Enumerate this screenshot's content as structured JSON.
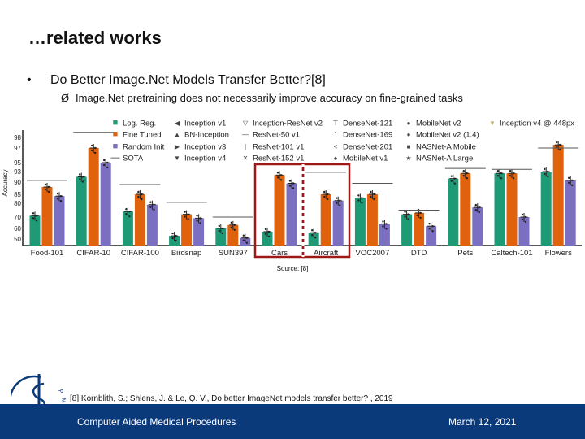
{
  "slide": {
    "title": "…related works",
    "bullet_symbol": "•",
    "bullet_text": "Do Better Image.Net Models Transfer Better?[8]",
    "sub_bullet_symbol": "Ø",
    "sub_bullet_text": "Image.Net pretraining does not necessarily improve accuracy on fine-grained tasks",
    "source": "Source: [8]",
    "reference": "[8] Kornblith, S.; Shlens, J. & Le, Q. V., Do better ImageNet models transfer better? , 2019",
    "footer_left": "Computer Aided Medical Procedures",
    "footer_right": "March 12, 2021",
    "logo_text": "CAMP",
    "footer_color": "#0b3a7a"
  },
  "chart_data": {
    "type": "bar",
    "ylabel": "Accuracy",
    "y_ticks": [
      50,
      60,
      70,
      80,
      85,
      90,
      93,
      95,
      97,
      98
    ],
    "y_scale": "nonlinear (logit-like)",
    "categories": [
      "Food-101",
      "CIFAR-10",
      "CIFAR-100",
      "Birdsnap",
      "SUN397",
      "Cars",
      "Aircraft",
      "VOC2007",
      "DTD",
      "Pets",
      "Caltech-101",
      "Flowers"
    ],
    "series": [
      {
        "name": "Log. Reg.",
        "color": "#1f9a77",
        "values": [
          71,
          91.5,
          74,
          53,
          60,
          57,
          56,
          83,
          72,
          91,
          92.5,
          93
        ]
      },
      {
        "name": "Fine Tuned",
        "color": "#e0620c",
        "values": [
          88,
          97,
          85,
          72,
          63,
          92,
          85,
          85,
          73,
          92.5,
          92.5,
          97.3
        ]
      },
      {
        "name": "Random Init",
        "color": "#7a6fc0",
        "values": [
          84,
          95,
          79,
          69,
          51,
          89.5,
          81.5,
          64,
          62,
          77,
          70,
          90.5
        ]
      },
      {
        "name": "SOTA",
        "color": "#333333",
        "values": [
          90.5,
          98.5,
          89,
          80.5,
          70,
          94,
          92.8,
          89.5,
          75,
          93.7,
          93.5,
          97
        ]
      }
    ],
    "legend_columns": [
      [
        "Log. Reg.",
        "Fine Tuned",
        "Random Init",
        "SOTA"
      ],
      [
        "Inception v1",
        "BN-Inception",
        "Inception v3",
        "Inception v4"
      ],
      [
        "Inception-ResNet v2",
        "ResNet-50 v1",
        "ResNet-101 v1",
        "ResNet-152 v1"
      ],
      [
        "DenseNet-121",
        "DenseNet-169",
        "DenseNet-201",
        "MobileNet v1"
      ],
      [
        "MobileNet v2",
        "MobileNet v2 (1.4)",
        "NASNet-A Mobile",
        "NASNet-A Large"
      ],
      [
        "Inception v4 @ 448px"
      ]
    ],
    "legend_markers": [
      [
        "■",
        "■",
        "■",
        "—"
      ],
      [
        "◀",
        "▲",
        "▶",
        "▼"
      ],
      [
        "▽",
        "—",
        "|",
        "✕"
      ],
      [
        "⊤",
        "⌃",
        "<",
        "♠"
      ],
      [
        "●",
        "●",
        "■",
        "★"
      ],
      [
        "▼"
      ]
    ],
    "legend_marker_colors": [
      "#1f9a77",
      "#e0620c",
      "#7a6fc0",
      "#333333"
    ],
    "legend_placement": "top",
    "highlighted_categories": [
      "Cars",
      "Aircraft"
    ],
    "highlight_color": "#a01818"
  }
}
